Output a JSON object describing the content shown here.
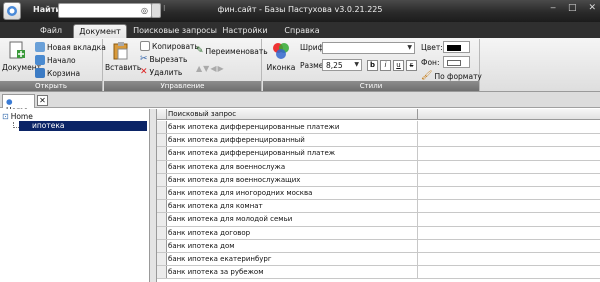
{
  "titlebar": {
    "find_label": "Найти:",
    "window_title": "фин.сайт - Базы Пастухова v3.0.21.225",
    "min": "‒",
    "max": "□",
    "close": "✕"
  },
  "tabs": [
    {
      "label": "Файл"
    },
    {
      "label": "Документ"
    },
    {
      "label": "Поисковые запросы"
    },
    {
      "label": "Настройки"
    },
    {
      "label": "Справка"
    }
  ],
  "ribbon": {
    "open_group": {
      "label": "Открыть",
      "document": "Документ",
      "new_tab": "Новая вкладка",
      "start": "Начало",
      "basket": "Корзина"
    },
    "manage_group": {
      "label": "Управление",
      "paste": "Вставить",
      "copy": "Копировать",
      "cut": "Вырезать",
      "delete": "Удалить",
      "rename": "Переименовать"
    },
    "styles_group": {
      "label": "Стили",
      "icon_btn": "Иконка",
      "font_label": "Шрифт",
      "size_label": "Размер",
      "size_value": "8,25",
      "bold": "b",
      "italic": "i",
      "underline": "u",
      "strike": "s",
      "color_label": "Цвет:",
      "bg_label": "Фон:",
      "by_format": "По формату"
    }
  },
  "doc_tab": {
    "label": "Home",
    "close": "✕"
  },
  "tree": {
    "root": "Home",
    "child": "ипотека"
  },
  "grid": {
    "column_header": "Поисковый запрос",
    "rows": [
      "банк ипотека дифференцированные платежи",
      "банк ипотека дифференцированный",
      "банк ипотека дифференцированный платеж",
      "банк ипотека для военнослужа",
      "банк ипотека для военнослужащих",
      "банк ипотека для иногородних москва",
      "банк ипотека для комнат",
      "банк ипотека для молодой семьи",
      "банк ипотека договор",
      "банк ипотека дом",
      "банк ипотека екатеринбург",
      "банк ипотека за рубежом"
    ]
  }
}
